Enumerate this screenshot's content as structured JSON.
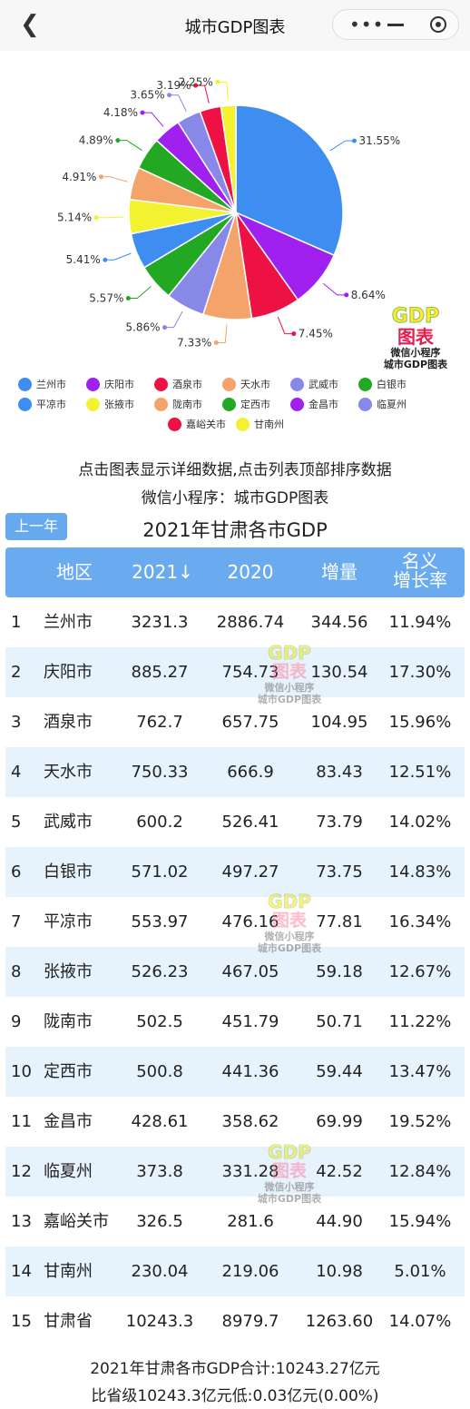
{
  "nav": {
    "title": "城市GDP图表",
    "back_icon": "chevron-left-icon",
    "more_icon": "more-dots-icon",
    "minimize_icon": "minus-icon",
    "close_icon": "target-icon"
  },
  "colors": {
    "header_bg": "#6aabf0",
    "row_alt": "#e6f2fc"
  },
  "chart_data": {
    "type": "pie",
    "slices": [
      {
        "name": "兰州市",
        "pct_label": "31.55%",
        "value": 31.55,
        "color": "#3d8ef0"
      },
      {
        "name": "庆阳市",
        "pct_label": "8.64%",
        "value": 8.64,
        "color": "#a020f0"
      },
      {
        "name": "酒泉市",
        "pct_label": "7.45%",
        "value": 7.45,
        "color": "#ee1144"
      },
      {
        "name": "天水市",
        "pct_label": "7.33%",
        "value": 7.33,
        "color": "#f4a46a"
      },
      {
        "name": "武威市",
        "pct_label": "5.86%",
        "value": 5.86,
        "color": "#8888e8"
      },
      {
        "name": "白银市",
        "pct_label": "5.57%",
        "value": 5.57,
        "color": "#22a822"
      },
      {
        "name": "平凉市",
        "pct_label": "5.41%",
        "value": 5.41,
        "color": "#3d8ef0"
      },
      {
        "name": "张掖市",
        "pct_label": "5.14%",
        "value": 5.14,
        "color": "#f2f230"
      },
      {
        "name": "陇南市",
        "pct_label": "4.91%",
        "value": 4.91,
        "color": "#f4a46a"
      },
      {
        "name": "定西市",
        "pct_label": "4.89%",
        "value": 4.89,
        "color": "#22a822"
      },
      {
        "name": "金昌市",
        "pct_label": "4.18%",
        "value": 4.18,
        "color": "#a020f0"
      },
      {
        "name": "临夏州",
        "pct_label": "3.65%",
        "value": 3.65,
        "color": "#8888e8"
      },
      {
        "name": "嘉峪关市",
        "pct_label": "3.19%",
        "value": 3.19,
        "color": "#ee1144"
      },
      {
        "name": "甘南州",
        "pct_label": "2.25%",
        "value": 2.25,
        "color": "#f2f230"
      }
    ]
  },
  "badge": {
    "gdp": "GDP",
    "tubiao": "图表",
    "line1": "微信小程序",
    "line2": "城市GDP图表"
  },
  "hint": {
    "line1": "点击图表显示详细数据,点击列表顶部排序数据",
    "line2": "微信小程序：城市GDP图表"
  },
  "table": {
    "prev_button": "上一年",
    "title": "2021年甘肃各市GDP",
    "headers": {
      "region": "地区",
      "y2021": "2021↓",
      "y2020": "2020",
      "increase": "增量",
      "rate1": "名义",
      "rate2": "增长率"
    },
    "rows": [
      {
        "idx": "1",
        "region": "兰州市",
        "y2021": "3231.3",
        "y2020": "2886.74",
        "inc": "344.56",
        "rate": "11.94%"
      },
      {
        "idx": "2",
        "region": "庆阳市",
        "y2021": "885.27",
        "y2020": "754.73",
        "inc": "130.54",
        "rate": "17.30%"
      },
      {
        "idx": "3",
        "region": "酒泉市",
        "y2021": "762.7",
        "y2020": "657.75",
        "inc": "104.95",
        "rate": "15.96%"
      },
      {
        "idx": "4",
        "region": "天水市",
        "y2021": "750.33",
        "y2020": "666.9",
        "inc": "83.43",
        "rate": "12.51%"
      },
      {
        "idx": "5",
        "region": "武威市",
        "y2021": "600.2",
        "y2020": "526.41",
        "inc": "73.79",
        "rate": "14.02%"
      },
      {
        "idx": "6",
        "region": "白银市",
        "y2021": "571.02",
        "y2020": "497.27",
        "inc": "73.75",
        "rate": "14.83%"
      },
      {
        "idx": "7",
        "region": "平凉市",
        "y2021": "553.97",
        "y2020": "476.16",
        "inc": "77.81",
        "rate": "16.34%"
      },
      {
        "idx": "8",
        "region": "张掖市",
        "y2021": "526.23",
        "y2020": "467.05",
        "inc": "59.18",
        "rate": "12.67%"
      },
      {
        "idx": "9",
        "region": "陇南市",
        "y2021": "502.5",
        "y2020": "451.79",
        "inc": "50.71",
        "rate": "11.22%"
      },
      {
        "idx": "10",
        "region": "定西市",
        "y2021": "500.8",
        "y2020": "441.36",
        "inc": "59.44",
        "rate": "13.47%"
      },
      {
        "idx": "11",
        "region": "金昌市",
        "y2021": "428.61",
        "y2020": "358.62",
        "inc": "69.99",
        "rate": "19.52%"
      },
      {
        "idx": "12",
        "region": "临夏州",
        "y2021": "373.8",
        "y2020": "331.28",
        "inc": "42.52",
        "rate": "12.84%"
      },
      {
        "idx": "13",
        "region": "嘉峪关市",
        "y2021": "326.5",
        "y2020": "281.6",
        "inc": "44.90",
        "rate": "15.94%"
      },
      {
        "idx": "14",
        "region": "甘南州",
        "y2021": "230.04",
        "y2020": "219.06",
        "inc": "10.98",
        "rate": "5.01%"
      },
      {
        "idx": "15",
        "region": "甘肃省",
        "y2021": "10243.3",
        "y2020": "8979.7",
        "inc": "1263.60",
        "rate": "14.07%"
      }
    ]
  },
  "watermark": {
    "gdp": "GDP",
    "tubiao": "图表",
    "line1": "微信小程序",
    "line2": "城市GDP图表"
  },
  "footer": {
    "line1": "2021年甘肃各市GDP合计:10243.27亿元",
    "line2": "比省级10243.3亿元低:0.03亿元(0.00%)"
  }
}
